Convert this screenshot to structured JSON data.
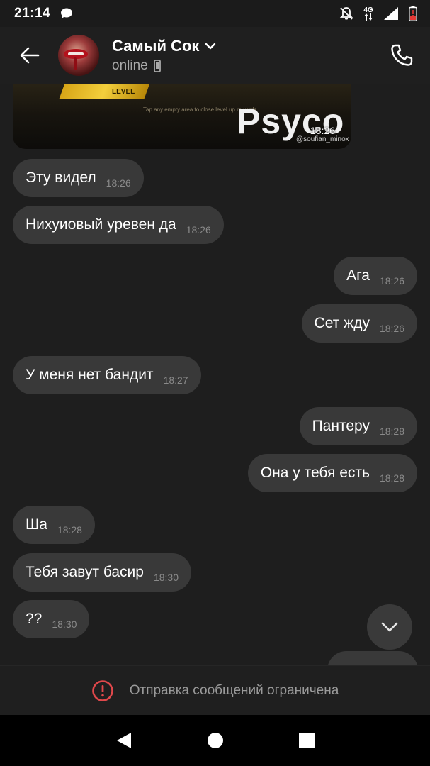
{
  "status_bar": {
    "time": "21:14",
    "network_label": "4G"
  },
  "header": {
    "contact_name": "Самый Сок",
    "status": "online"
  },
  "media": {
    "banner_text": "LEVEL",
    "hint_text": "Tap any empty area to close level up rewards",
    "big_text": "Psyco",
    "time": "18:26",
    "user_tag": "@soufian_minox"
  },
  "messages": [
    {
      "text": "Эту видел",
      "time": "18:26",
      "side": "in"
    },
    {
      "text": "Нихуиовый уревен да",
      "time": "18:26",
      "side": "in"
    },
    {
      "text": "Ага",
      "time": "18:26",
      "side": "out"
    },
    {
      "text": "Сет жду",
      "time": "18:26",
      "side": "out"
    },
    {
      "text": "У меня нет бандит",
      "time": "18:27",
      "side": "in"
    },
    {
      "text": "Пантеру",
      "time": "18:28",
      "side": "out"
    },
    {
      "text": "Она у тебя есть",
      "time": "18:28",
      "side": "out"
    },
    {
      "text": "Ша",
      "time": "18:28",
      "side": "in"
    },
    {
      "text": "Тебя завут басир",
      "time": "18:30",
      "side": "in"
    },
    {
      "text": "??",
      "time": "18:30",
      "side": "in"
    }
  ],
  "footer": {
    "restriction_text": "Отправка сообщений ограничена"
  },
  "colors": {
    "background": "#1e1e1e",
    "bubble": "#393939",
    "restriction_icon": "#e0484b"
  }
}
